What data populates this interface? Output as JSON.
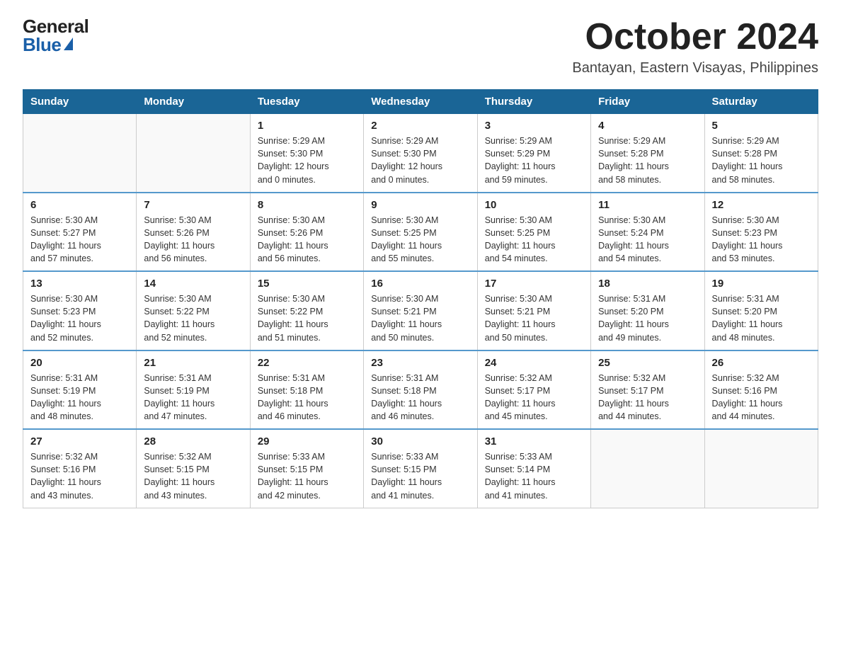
{
  "logo": {
    "general": "General",
    "blue": "Blue"
  },
  "header": {
    "month": "October 2024",
    "location": "Bantayan, Eastern Visayas, Philippines"
  },
  "weekdays": [
    "Sunday",
    "Monday",
    "Tuesday",
    "Wednesday",
    "Thursday",
    "Friday",
    "Saturday"
  ],
  "weeks": [
    [
      {
        "day": "",
        "info": ""
      },
      {
        "day": "",
        "info": ""
      },
      {
        "day": "1",
        "info": "Sunrise: 5:29 AM\nSunset: 5:30 PM\nDaylight: 12 hours\nand 0 minutes."
      },
      {
        "day": "2",
        "info": "Sunrise: 5:29 AM\nSunset: 5:30 PM\nDaylight: 12 hours\nand 0 minutes."
      },
      {
        "day": "3",
        "info": "Sunrise: 5:29 AM\nSunset: 5:29 PM\nDaylight: 11 hours\nand 59 minutes."
      },
      {
        "day": "4",
        "info": "Sunrise: 5:29 AM\nSunset: 5:28 PM\nDaylight: 11 hours\nand 58 minutes."
      },
      {
        "day": "5",
        "info": "Sunrise: 5:29 AM\nSunset: 5:28 PM\nDaylight: 11 hours\nand 58 minutes."
      }
    ],
    [
      {
        "day": "6",
        "info": "Sunrise: 5:30 AM\nSunset: 5:27 PM\nDaylight: 11 hours\nand 57 minutes."
      },
      {
        "day": "7",
        "info": "Sunrise: 5:30 AM\nSunset: 5:26 PM\nDaylight: 11 hours\nand 56 minutes."
      },
      {
        "day": "8",
        "info": "Sunrise: 5:30 AM\nSunset: 5:26 PM\nDaylight: 11 hours\nand 56 minutes."
      },
      {
        "day": "9",
        "info": "Sunrise: 5:30 AM\nSunset: 5:25 PM\nDaylight: 11 hours\nand 55 minutes."
      },
      {
        "day": "10",
        "info": "Sunrise: 5:30 AM\nSunset: 5:25 PM\nDaylight: 11 hours\nand 54 minutes."
      },
      {
        "day": "11",
        "info": "Sunrise: 5:30 AM\nSunset: 5:24 PM\nDaylight: 11 hours\nand 54 minutes."
      },
      {
        "day": "12",
        "info": "Sunrise: 5:30 AM\nSunset: 5:23 PM\nDaylight: 11 hours\nand 53 minutes."
      }
    ],
    [
      {
        "day": "13",
        "info": "Sunrise: 5:30 AM\nSunset: 5:23 PM\nDaylight: 11 hours\nand 52 minutes."
      },
      {
        "day": "14",
        "info": "Sunrise: 5:30 AM\nSunset: 5:22 PM\nDaylight: 11 hours\nand 52 minutes."
      },
      {
        "day": "15",
        "info": "Sunrise: 5:30 AM\nSunset: 5:22 PM\nDaylight: 11 hours\nand 51 minutes."
      },
      {
        "day": "16",
        "info": "Sunrise: 5:30 AM\nSunset: 5:21 PM\nDaylight: 11 hours\nand 50 minutes."
      },
      {
        "day": "17",
        "info": "Sunrise: 5:30 AM\nSunset: 5:21 PM\nDaylight: 11 hours\nand 50 minutes."
      },
      {
        "day": "18",
        "info": "Sunrise: 5:31 AM\nSunset: 5:20 PM\nDaylight: 11 hours\nand 49 minutes."
      },
      {
        "day": "19",
        "info": "Sunrise: 5:31 AM\nSunset: 5:20 PM\nDaylight: 11 hours\nand 48 minutes."
      }
    ],
    [
      {
        "day": "20",
        "info": "Sunrise: 5:31 AM\nSunset: 5:19 PM\nDaylight: 11 hours\nand 48 minutes."
      },
      {
        "day": "21",
        "info": "Sunrise: 5:31 AM\nSunset: 5:19 PM\nDaylight: 11 hours\nand 47 minutes."
      },
      {
        "day": "22",
        "info": "Sunrise: 5:31 AM\nSunset: 5:18 PM\nDaylight: 11 hours\nand 46 minutes."
      },
      {
        "day": "23",
        "info": "Sunrise: 5:31 AM\nSunset: 5:18 PM\nDaylight: 11 hours\nand 46 minutes."
      },
      {
        "day": "24",
        "info": "Sunrise: 5:32 AM\nSunset: 5:17 PM\nDaylight: 11 hours\nand 45 minutes."
      },
      {
        "day": "25",
        "info": "Sunrise: 5:32 AM\nSunset: 5:17 PM\nDaylight: 11 hours\nand 44 minutes."
      },
      {
        "day": "26",
        "info": "Sunrise: 5:32 AM\nSunset: 5:16 PM\nDaylight: 11 hours\nand 44 minutes."
      }
    ],
    [
      {
        "day": "27",
        "info": "Sunrise: 5:32 AM\nSunset: 5:16 PM\nDaylight: 11 hours\nand 43 minutes."
      },
      {
        "day": "28",
        "info": "Sunrise: 5:32 AM\nSunset: 5:15 PM\nDaylight: 11 hours\nand 43 minutes."
      },
      {
        "day": "29",
        "info": "Sunrise: 5:33 AM\nSunset: 5:15 PM\nDaylight: 11 hours\nand 42 minutes."
      },
      {
        "day": "30",
        "info": "Sunrise: 5:33 AM\nSunset: 5:15 PM\nDaylight: 11 hours\nand 41 minutes."
      },
      {
        "day": "31",
        "info": "Sunrise: 5:33 AM\nSunset: 5:14 PM\nDaylight: 11 hours\nand 41 minutes."
      },
      {
        "day": "",
        "info": ""
      },
      {
        "day": "",
        "info": ""
      }
    ]
  ]
}
